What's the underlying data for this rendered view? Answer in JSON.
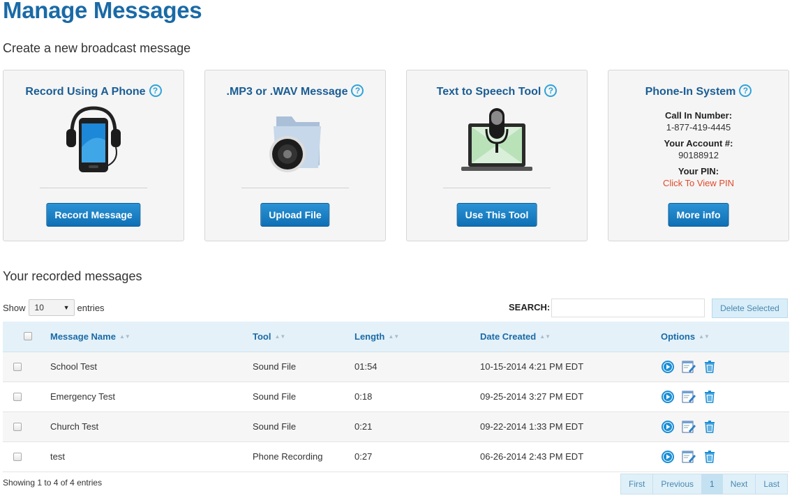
{
  "page": {
    "title": "Manage Messages",
    "create_heading": "Create a new broadcast message",
    "recorded_heading": "Your recorded messages"
  },
  "cards": [
    {
      "title": "Record Using A Phone",
      "button": "Record Message",
      "icon": "phone-headphones-icon"
    },
    {
      "title": ".MP3 or .WAV Message",
      "button": "Upload File",
      "icon": "folder-audio-icon"
    },
    {
      "title": "Text to Speech Tool",
      "button": "Use This Tool",
      "icon": "laptop-microphone-icon"
    },
    {
      "title": "Phone-In System",
      "button": "More info",
      "icon": "none"
    }
  ],
  "phone_in": {
    "call_in_label": "Call In Number:",
    "call_in_number": "1-877-419-4445",
    "account_label": "Your Account #:",
    "account_number": "90188912",
    "pin_label": "Your PIN:",
    "pin_link": "Click To View PIN"
  },
  "table_controls": {
    "show_label": "Show",
    "entries_label": "entries",
    "page_size": "10",
    "search_label": "SEARCH:",
    "search_value": "",
    "delete_selected": "Delete Selected"
  },
  "table": {
    "columns": [
      "Message Name",
      "Tool",
      "Length",
      "Date Created",
      "Options"
    ],
    "rows": [
      {
        "name": "School Test",
        "tool": "Sound File",
        "length": "01:54",
        "date": "10-15-2014 4:21 PM EDT"
      },
      {
        "name": "Emergency Test",
        "tool": "Sound File",
        "length": "0:18",
        "date": "09-25-2014 3:27 PM EDT"
      },
      {
        "name": "Church Test",
        "tool": "Sound File",
        "length": "0:21",
        "date": "09-22-2014 1:33 PM EDT"
      },
      {
        "name": "test",
        "tool": "Phone Recording",
        "length": "0:27",
        "date": "06-26-2014 2:43 PM EDT"
      }
    ]
  },
  "footer": {
    "info": "Showing 1 to 4 of 4 entries",
    "pager": [
      "First",
      "Previous",
      "1",
      "Next",
      "Last"
    ],
    "current_page": "1"
  },
  "colors": {
    "title": "#1a6aa6",
    "button": "#1578be",
    "help_icon": "#2ea3da",
    "pin_link": "#e04a2a",
    "table_header_bg": "#e4f1f9"
  }
}
